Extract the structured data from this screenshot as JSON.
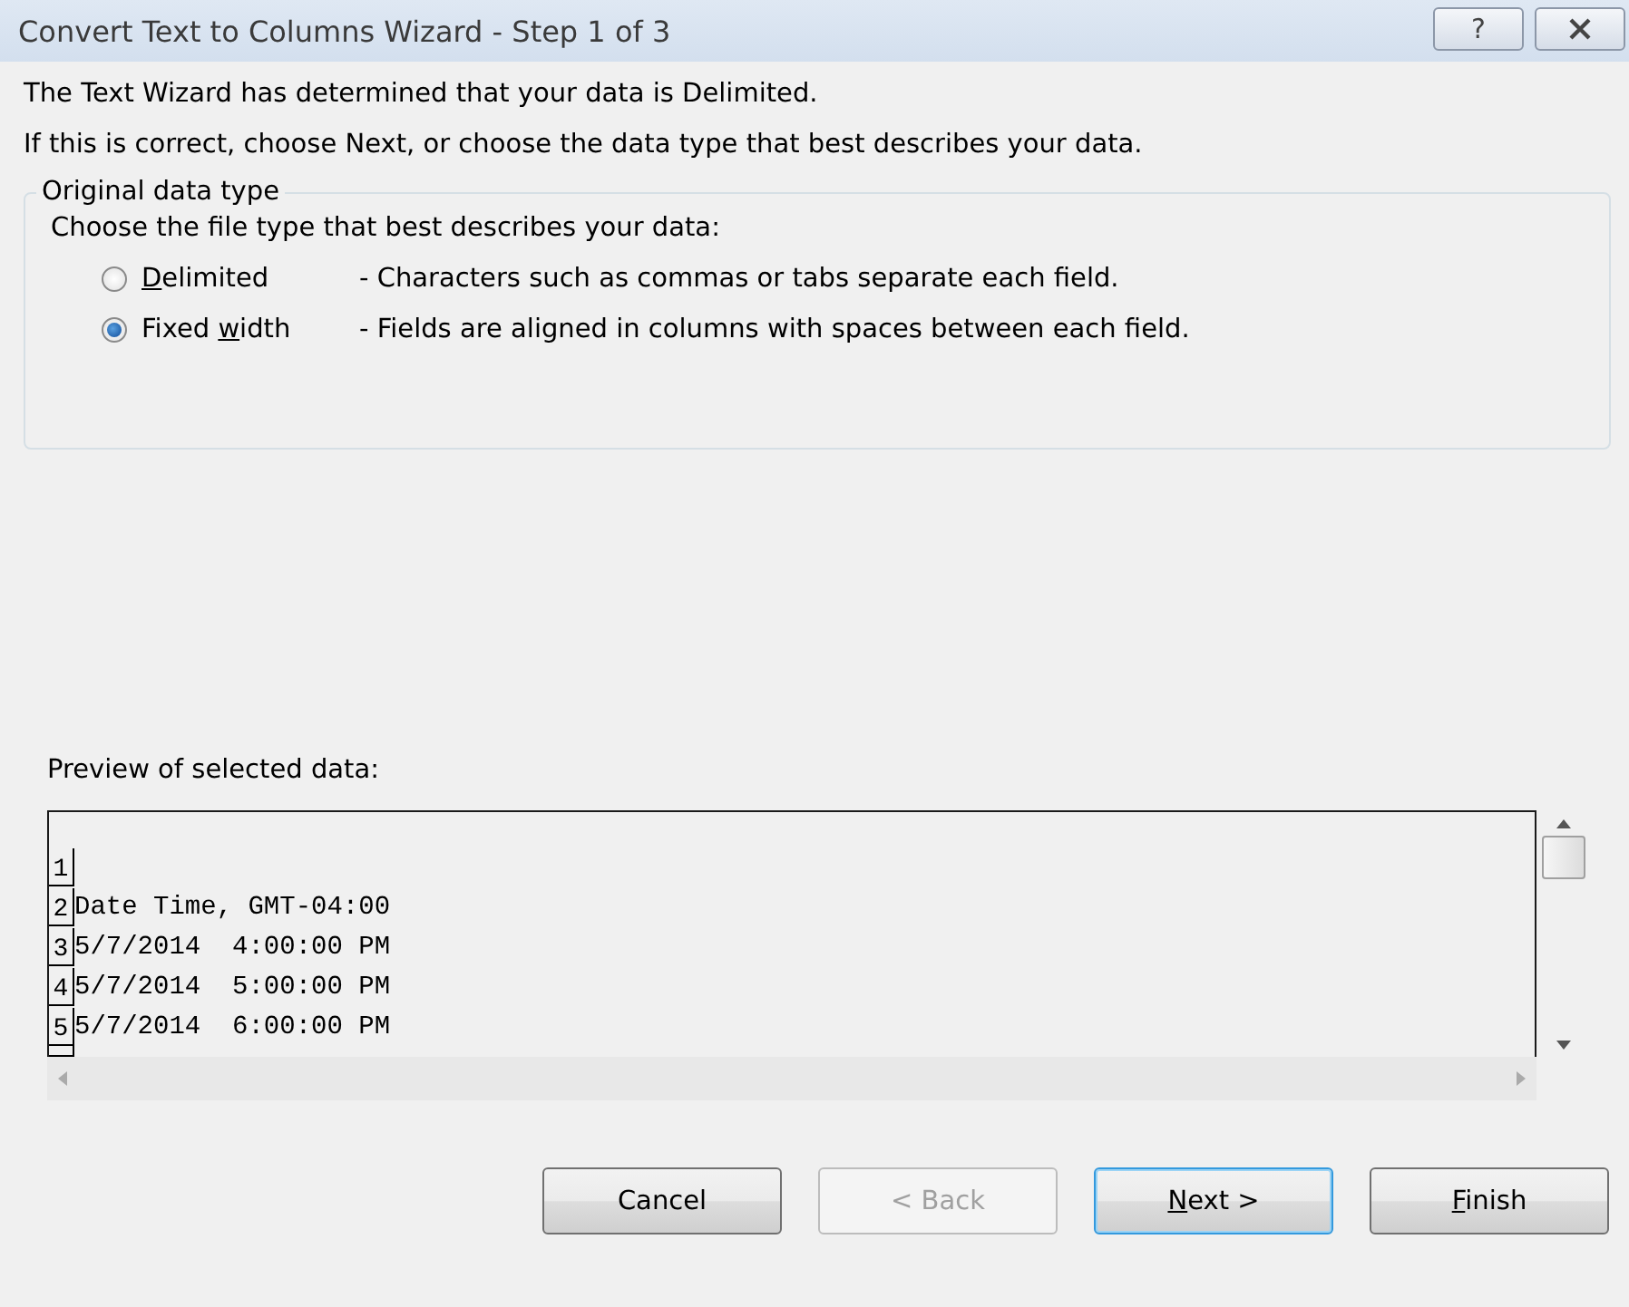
{
  "window": {
    "title": "Convert Text to Columns Wizard - Step 1 of 3",
    "help_button": "?"
  },
  "intro": [
    "The Text Wizard has determined that your data is Delimited.",
    "If this is correct, choose Next, or choose the data type that best describes your data."
  ],
  "group": {
    "title": "Original data type",
    "prompt": "Choose the file type that best describes your data:",
    "options": [
      {
        "label": {
          "key": "D",
          "after": "elimited"
        },
        "description": "- Characters such as commas or tabs separate each field.",
        "selected": false
      },
      {
        "label": {
          "before": "Fixed ",
          "key": "w",
          "after": "idth"
        },
        "description": "- Fields are aligned in columns with spaces between each field.",
        "selected": true
      }
    ]
  },
  "preview": {
    "label": "Preview of selected data:",
    "rows": [
      {
        "number": "1",
        "text": ""
      },
      {
        "number": "2",
        "text": "Date Time, GMT-04:00"
      },
      {
        "number": "3",
        "text": "5/7/2014  4:00:00 PM"
      },
      {
        "number": "4",
        "text": "5/7/2014  5:00:00 PM"
      },
      {
        "number": "5",
        "text": "5/7/2014  6:00:00 PM"
      }
    ]
  },
  "buttons": [
    {
      "label": {
        "after": "Cancel"
      },
      "disabled": false,
      "default": false
    },
    {
      "label": {
        "after": "< Back"
      },
      "disabled": true,
      "default": false
    },
    {
      "label": {
        "key": "N",
        "after": "ext >"
      },
      "disabled": false,
      "default": true
    },
    {
      "label": {
        "key": "F",
        "after": "inish"
      },
      "disabled": false,
      "default": false
    }
  ]
}
